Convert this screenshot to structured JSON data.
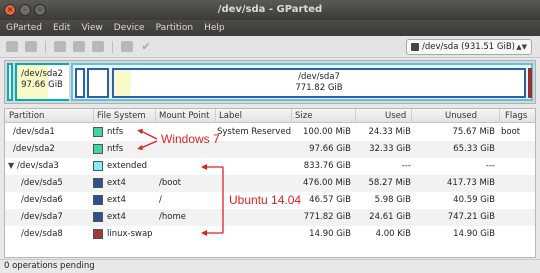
{
  "window": {
    "title": "/dev/sda - GParted"
  },
  "menu": [
    "GParted",
    "Edit",
    "View",
    "Device",
    "Partition",
    "Help"
  ],
  "device_selector": {
    "label": "/dev/sda  (931.51 GiB)"
  },
  "diskmap": {
    "sda2": {
      "name": "/dev/sda2",
      "size": "97.66 GiB"
    },
    "sda7": {
      "name": "/dev/sda7",
      "size": "771.82 GiB"
    }
  },
  "columns": [
    "Partition",
    "File System",
    "Mount Point",
    "Label",
    "Size",
    "Used",
    "Unused",
    "Flags"
  ],
  "rows": [
    {
      "partition": "/dev/sda1",
      "fs": "ntfs",
      "fs_color": "#42d69a",
      "mount": "",
      "label": "System Reserved",
      "size": "100.00 MiB",
      "used": "24.33 MiB",
      "unused": "75.67 MiB",
      "flags": "boot"
    },
    {
      "partition": "/dev/sda2",
      "fs": "ntfs",
      "fs_color": "#42d69a",
      "mount": "",
      "label": "",
      "size": "97.66 GiB",
      "used": "32.33 GiB",
      "unused": "65.33 GiB",
      "flags": ""
    },
    {
      "partition": "/dev/sda3",
      "fs": "extended",
      "fs_color": "#7ef0f2",
      "mount": "",
      "label": "",
      "size": "833.76 GiB",
      "used": "---",
      "unused": "---",
      "flags": ""
    },
    {
      "partition": "/dev/sda5",
      "fs": "ext4",
      "fs_color": "#2f4f8f",
      "mount": "/boot",
      "label": "",
      "size": "476.00 MiB",
      "used": "58.27 MiB",
      "unused": "417.73 MiB",
      "flags": ""
    },
    {
      "partition": "/dev/sda6",
      "fs": "ext4",
      "fs_color": "#2f4f8f",
      "mount": "/",
      "label": "",
      "size": "46.57 GiB",
      "used": "5.98 GiB",
      "unused": "40.59 GiB",
      "flags": ""
    },
    {
      "partition": "/dev/sda7",
      "fs": "ext4",
      "fs_color": "#2f4f8f",
      "mount": "/home",
      "label": "",
      "size": "771.82 GiB",
      "used": "24.61 GiB",
      "unused": "747.21 GiB",
      "flags": ""
    },
    {
      "partition": "/dev/sda8",
      "fs": "linux-swap",
      "fs_color": "#a03a3a",
      "mount": "",
      "label": "",
      "size": "14.90 GiB",
      "used": "4.00 KiB",
      "unused": "14.90 GiB",
      "flags": ""
    }
  ],
  "annotations": {
    "windows": "Windows 7",
    "ubuntu": "Ubuntu 14.04",
    "color": "#e02020"
  },
  "status": "0 operations pending"
}
